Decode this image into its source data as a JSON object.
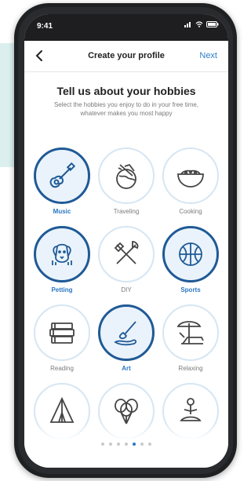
{
  "status_bar": {
    "time": "9:41"
  },
  "header": {
    "back_icon": "chevron-left-icon",
    "title": "Create your profile",
    "next_label": "Next"
  },
  "intro": {
    "heading": "Tell us about your hobbies",
    "subtitle": "Select the hobbies you enjoy to do in your free time, whatever makes you most happy"
  },
  "hobbies": [
    {
      "label": "Music",
      "icon": "guitar-icon",
      "selected": true
    },
    {
      "label": "Traveling",
      "icon": "airplane-globe-icon",
      "selected": false
    },
    {
      "label": "Cooking",
      "icon": "bowl-icon",
      "selected": false
    },
    {
      "label": "Petting",
      "icon": "dog-icon",
      "selected": true
    },
    {
      "label": "DIY",
      "icon": "tools-icon",
      "selected": false
    },
    {
      "label": "Sports",
      "icon": "basketball-icon",
      "selected": true
    },
    {
      "label": "Reading",
      "icon": "books-icon",
      "selected": false
    },
    {
      "label": "Art",
      "icon": "paintbrush-icon",
      "selected": true
    },
    {
      "label": "Relaxing",
      "icon": "beach-chair-icon",
      "selected": false
    },
    {
      "label": "",
      "icon": "camping-icon",
      "selected": false
    },
    {
      "label": "",
      "icon": "balloons-icon",
      "selected": false
    },
    {
      "label": "",
      "icon": "meditation-icon",
      "selected": false
    }
  ],
  "pagination": {
    "count": 7,
    "active_index": 4
  },
  "colors": {
    "accent": "#2a78c2",
    "selected_ring": "#1f5a96",
    "background_band": "#dcefef"
  }
}
